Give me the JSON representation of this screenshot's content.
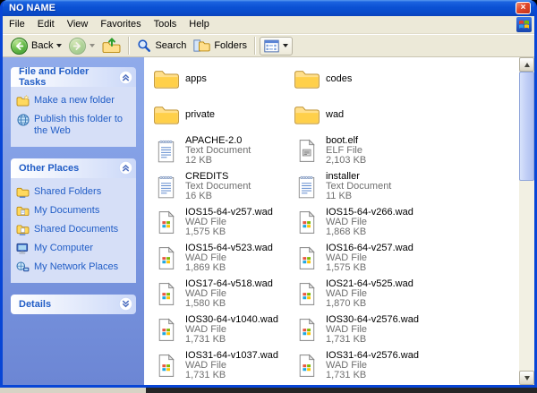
{
  "colors": {
    "titlebar_blue": "#0B51D4",
    "window_border_blue": "#0846D6",
    "task_pane_blue": "#7E9BE3",
    "task_link_blue": "#215DC6",
    "menubar_beige": "#ECE9D8"
  },
  "window": {
    "title": "NO NAME",
    "close_glyph": "×"
  },
  "menu": [
    "File",
    "Edit",
    "View",
    "Favorites",
    "Tools",
    "Help"
  ],
  "toolbar": {
    "buttons": [
      {
        "icon": "back-arrow-icon",
        "label": "Back",
        "dropdown": true,
        "disabled": false
      },
      {
        "icon": "forward-arrow-icon",
        "label": "",
        "dropdown": true,
        "disabled": true
      },
      {
        "icon": "up-folder-icon",
        "label": "",
        "dropdown": false,
        "disabled": false
      },
      {
        "icon": "search-icon",
        "label": "Search",
        "dropdown": false,
        "disabled": false
      },
      {
        "icon": "folders-icon",
        "label": "Folders",
        "dropdown": false,
        "disabled": false
      },
      {
        "icon": "views-icon",
        "label": "",
        "dropdown": true,
        "disabled": false
      }
    ]
  },
  "sidebar": [
    {
      "id": "file-and-folder-tasks",
      "title": "File and Folder Tasks",
      "collapsed": false,
      "items": [
        {
          "icon": "new-folder-icon",
          "label": "Make a new folder"
        },
        {
          "icon": "publish-web-icon",
          "label": "Publish this folder to the Web"
        }
      ]
    },
    {
      "id": "other-places",
      "title": "Other Places",
      "collapsed": false,
      "items": [
        {
          "icon": "shared-folder-icon",
          "label": "Shared Folders"
        },
        {
          "icon": "my-documents-icon",
          "label": "My Documents"
        },
        {
          "icon": "shared-documents-icon",
          "label": "Shared Documents"
        },
        {
          "icon": "my-computer-icon",
          "label": "My Computer"
        },
        {
          "icon": "network-places-icon",
          "label": "My Network Places"
        }
      ]
    },
    {
      "id": "details",
      "title": "Details",
      "collapsed": true,
      "items": []
    }
  ],
  "files": {
    "view": "tiles",
    "columns": [
      [
        {
          "name": "apps",
          "icon": "folder-icon"
        },
        {
          "name": "private",
          "icon": "folder-icon"
        },
        {
          "name": "APACHE-2.0",
          "type": "Text Document",
          "size": "12 KB",
          "icon": "text-document-icon"
        },
        {
          "name": "CREDITS",
          "type": "Text Document",
          "size": "16 KB",
          "icon": "text-document-icon"
        },
        {
          "name": "IOS15-64-v257.wad",
          "type": "WAD File",
          "size": "1,575 KB",
          "icon": "wad-file-icon"
        },
        {
          "name": "IOS15-64-v523.wad",
          "type": "WAD File",
          "size": "1,869 KB",
          "icon": "wad-file-icon"
        },
        {
          "name": "IOS17-64-v518.wad",
          "type": "WAD File",
          "size": "1,580 KB",
          "icon": "wad-file-icon"
        },
        {
          "name": "IOS30-64-v1040.wad",
          "type": "WAD File",
          "size": "1,731 KB",
          "icon": "wad-file-icon"
        },
        {
          "name": "IOS31-64-v1037.wad",
          "type": "WAD File",
          "size": "1,731 KB",
          "icon": "wad-file-icon"
        }
      ],
      [
        {
          "name": "codes",
          "icon": "folder-icon"
        },
        {
          "name": "wad",
          "icon": "folder-icon"
        },
        {
          "name": "boot.elf",
          "type": "ELF File",
          "size": "2,103 KB",
          "icon": "elf-file-icon"
        },
        {
          "name": "installer",
          "type": "Text Document",
          "size": "11 KB",
          "icon": "text-document-icon"
        },
        {
          "name": "IOS15-64-v266.wad",
          "type": "WAD File",
          "size": "1,868 KB",
          "icon": "wad-file-icon"
        },
        {
          "name": "IOS16-64-v257.wad",
          "type": "WAD File",
          "size": "1,575 KB",
          "icon": "wad-file-icon"
        },
        {
          "name": "IOS21-64-v525.wad",
          "type": "WAD File",
          "size": "1,870 KB",
          "icon": "wad-file-icon"
        },
        {
          "name": "IOS30-64-v2576.wad",
          "type": "WAD File",
          "size": "1,731 KB",
          "icon": "wad-file-icon"
        },
        {
          "name": "IOS31-64-v2576.wad",
          "type": "WAD File",
          "size": "1,731 KB",
          "icon": "wad-file-icon"
        }
      ]
    ]
  }
}
